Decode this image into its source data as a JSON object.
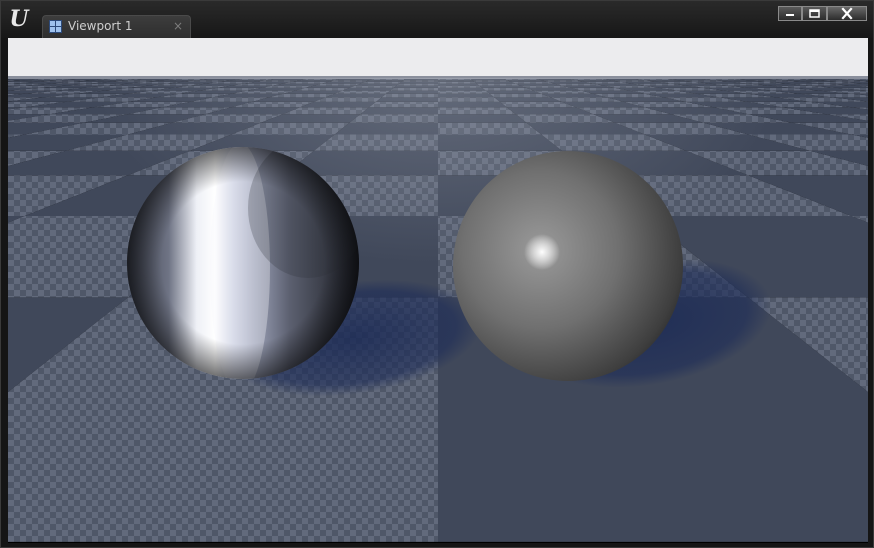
{
  "window": {
    "logo_glyph": "U",
    "tab": {
      "label": "Viewport 1",
      "close_glyph": "×",
      "icon": "viewport-grid-icon"
    },
    "controls": [
      "minimize-icon",
      "maximize-icon",
      "close-icon"
    ]
  },
  "scene": {
    "floor_dark": "#40485a",
    "floor_light": "#5e6678",
    "sky_color": "#ececee",
    "objects": [
      "chrome-sphere",
      "gray-sphere"
    ]
  }
}
